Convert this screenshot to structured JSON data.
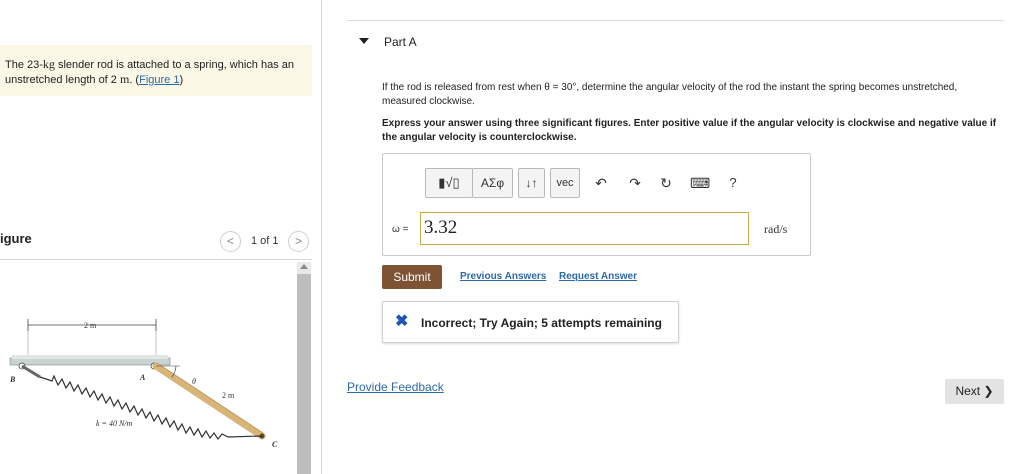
{
  "problem": {
    "text_before": "The 23-",
    "unit_kg": "kg",
    "text_mid": " slender rod is attached to a spring, which has an unstretched length of 2 ",
    "unit_m": "m",
    "text_after": ". (",
    "figure_link": "Figure 1",
    "close_paren": ")"
  },
  "figure_panel": {
    "title": "igure",
    "prev_glyph": "<",
    "next_glyph": ">",
    "page_indicator": "1 of 1"
  },
  "figure_labels": {
    "top_dimension": "2 m",
    "rod_length": "2 m",
    "spring_constant": "k = 40 N/m",
    "point_a": "A",
    "point_b": "B",
    "point_c": "C",
    "angle": "θ"
  },
  "part": {
    "title": "Part A",
    "question": "If the rod is released from rest when θ = 30°, determine the angular velocity of the rod the instant the spring becomes unstretched, measured clockwise.",
    "instructions": "Express your answer using three significant figures. Enter positive value if the angular velocity is clockwise and negative value if the angular velocity is counterclockwise."
  },
  "toolbar": {
    "templates_label": "▮√▯",
    "greek_label": "ΑΣφ",
    "arrows_label": "↓↑",
    "vec_label": "vec",
    "undo_glyph": "↶",
    "redo_glyph": "↷",
    "reset_glyph": "↻",
    "keyboard_glyph": "⌨",
    "help_label": "?"
  },
  "answer": {
    "variable_label": "ω =",
    "value": "3.32",
    "unit": "rad/s"
  },
  "actions": {
    "submit_label": "Submit",
    "previous_answers_label": "Previous Answers",
    "request_answer_label": "Request Answer"
  },
  "feedback": {
    "icon_glyph": "✖",
    "message": "Incorrect; Try Again; 5 attempts remaining"
  },
  "footer": {
    "provide_feedback_label": "Provide Feedback",
    "next_label": "Next ❯"
  },
  "colors": {
    "submit_bg": "#7d5334",
    "link": "#2c6aa8",
    "problem_bg": "#faf7e6",
    "incorrect_icon": "#1f55b4",
    "input_border": "#c8a94a",
    "rod_color": "#d7b577"
  }
}
